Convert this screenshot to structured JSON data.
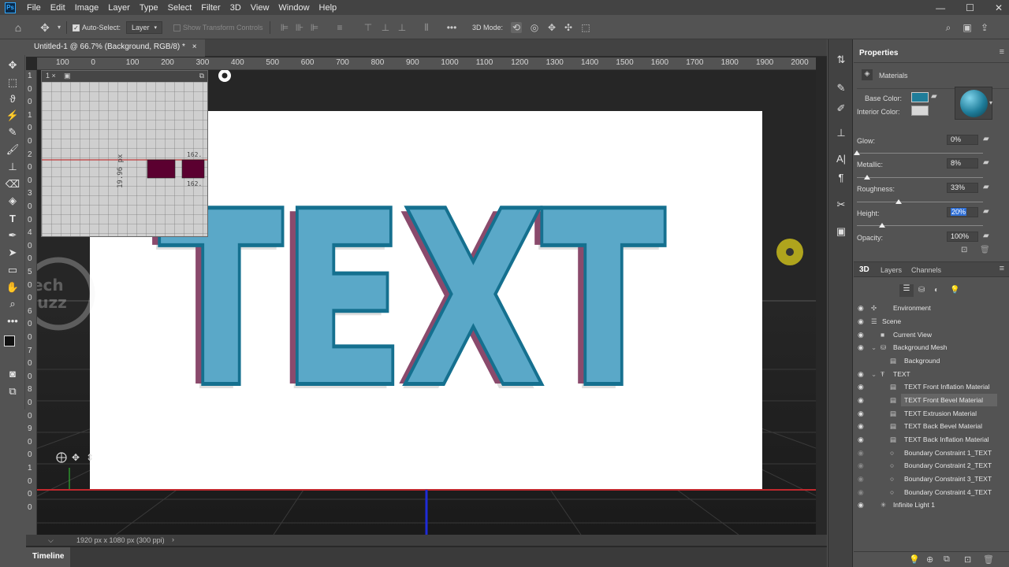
{
  "menubar": {
    "logo": "Ps",
    "items": [
      "File",
      "Edit",
      "Image",
      "Layer",
      "Type",
      "Select",
      "Filter",
      "3D",
      "View",
      "Window",
      "Help"
    ],
    "window_controls": [
      "—",
      "☐",
      "✕"
    ]
  },
  "options": {
    "auto_select_label": "Auto-Select:",
    "auto_select_target": "Layer",
    "show_transform_label": "Show Transform Controls",
    "mode_label": "3D Mode:",
    "more": "•••"
  },
  "document": {
    "tab_title": "Untitled-1 @ 66.7% (Background, RGB/8) *",
    "close": "×",
    "status": "1920 px x 1080 px (300 ppi)",
    "status_arrow": "›"
  },
  "ruler": {
    "h_labels": [
      "100",
      "0",
      "100",
      "200",
      "300",
      "400",
      "500",
      "600",
      "700",
      "800",
      "900",
      "1000",
      "1100",
      "1200",
      "1300",
      "1400",
      "1500",
      "1600",
      "1700",
      "1800",
      "1900",
      "2000"
    ],
    "v_labels": [
      "1",
      "0",
      "0",
      "1",
      "0",
      "0",
      "2",
      "0",
      "0",
      "3",
      "0",
      "0",
      "4",
      "0",
      "0",
      "5",
      "0",
      "0",
      "6",
      "0",
      "0",
      "7",
      "0",
      "0",
      "8",
      "0",
      "0",
      "9",
      "0",
      "0",
      "1",
      "0",
      "0",
      "0"
    ]
  },
  "overlay": {
    "header": "1 ×",
    "measure_vertical": "19.96 px",
    "measure_top": "162.",
    "measure_bottom": "162."
  },
  "canvas_text": "TEXT",
  "watermark": {
    "line1": "Tech",
    "line2": "Buzz"
  },
  "timeline_tab": "Timeline",
  "properties": {
    "tab": "Properties",
    "section": "Materials",
    "base_color_label": "Base Color:",
    "interior_color_label": "Interior Color:",
    "base_color": "#1f7d9a",
    "interior_color": "#d8d8d8",
    "glow_label": "Glow:",
    "glow_value": "0%",
    "glow_level": 0,
    "metallic_label": "Metallic:",
    "metallic_value": "8%",
    "metallic_level": 8,
    "roughness_label": "Roughness:",
    "roughness_value": "33%",
    "roughness_level": 33,
    "height_label": "Height:",
    "height_value": "20%",
    "height_level": 20,
    "opacity_label": "Opacity:",
    "opacity_value": "100%"
  },
  "panel3d": {
    "tabs": [
      "3D",
      "Layers",
      "Channels"
    ],
    "rows": [
      {
        "label": "Environment"
      },
      {
        "label": "Scene"
      },
      {
        "label": "Current View"
      },
      {
        "label": "Background Mesh"
      },
      {
        "label": "Background"
      },
      {
        "label": "TEXT"
      },
      {
        "label": "TEXT Front Inflation Material"
      },
      {
        "label": "TEXT Front Bevel Material"
      },
      {
        "label": "TEXT Extrusion Material"
      },
      {
        "label": "TEXT Back Bevel Material"
      },
      {
        "label": "TEXT Back Inflation Material"
      },
      {
        "label": "Boundary Constraint 1_TEXT"
      },
      {
        "label": "Boundary Constraint 2_TEXT"
      },
      {
        "label": "Boundary Constraint 3_TEXT"
      },
      {
        "label": "Boundary Constraint 4_TEXT"
      },
      {
        "label": "Infinite Light 1"
      }
    ]
  }
}
